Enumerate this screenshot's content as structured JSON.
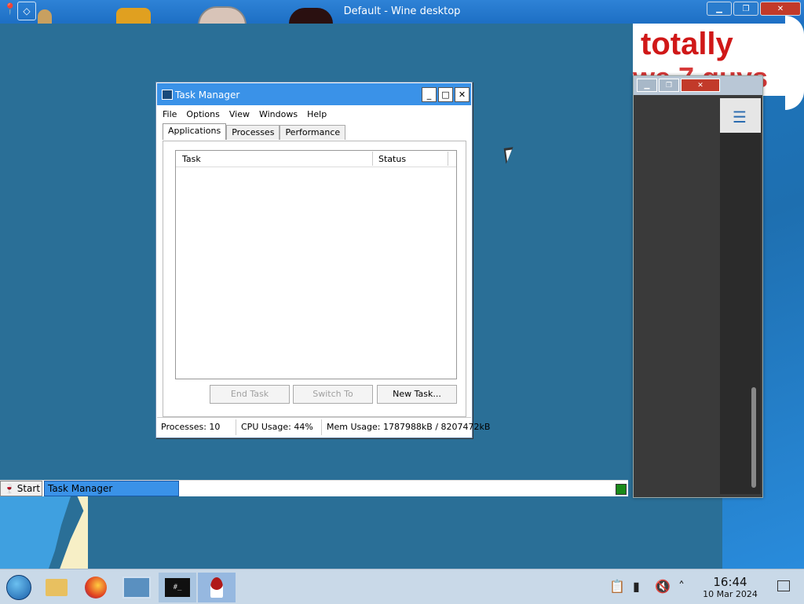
{
  "wine_window": {
    "title": "Default - Wine desktop",
    "ctrl_min": "▁",
    "ctrl_max": "❐",
    "ctrl_close": "✕"
  },
  "sticker": {
    "line1": "totally",
    "line2": "we 7 guys"
  },
  "right_window": {
    "ctrl_min": "▁",
    "ctrl_max": "❐",
    "ctrl_close": "✕",
    "menu_icon": "hamburger-icon"
  },
  "task_manager": {
    "title": "Task Manager",
    "ctrl_min": "_",
    "ctrl_max": "□",
    "ctrl_close": "✕",
    "menu": [
      "File",
      "Options",
      "View",
      "Windows",
      "Help"
    ],
    "tabs": [
      "Applications",
      "Processes",
      "Performance"
    ],
    "active_tab": "Applications",
    "columns": [
      "Task",
      "Status"
    ],
    "rows": [],
    "buttons": {
      "end_task": "End Task",
      "switch_to": "Switch To",
      "new_task": "New Task..."
    },
    "status": {
      "processes": "Processes: 10",
      "cpu": "CPU Usage:  44%",
      "mem": "Mem Usage: 1787988kB / 8207472kB"
    }
  },
  "wine_taskbar": {
    "start_label": "Start",
    "task_label": "Task Manager"
  },
  "host_taskbar": {
    "icons": [
      "start-orb-icon",
      "file-manager-icon",
      "firefox-icon",
      "network-icon",
      "terminal-icon",
      "wine-icon"
    ],
    "terminal_text": "#_",
    "clock_time": "16:44",
    "clock_date": "10 Mar 2024",
    "tray_icons": [
      "clipboard-icon",
      "battery-icon",
      "volume-muted-icon",
      "chevron-up-icon"
    ]
  },
  "colors": {
    "wine_desktop": "#2a6f97",
    "titlebar_blue": "#3a92e8",
    "close_red": "#c23a2a"
  }
}
